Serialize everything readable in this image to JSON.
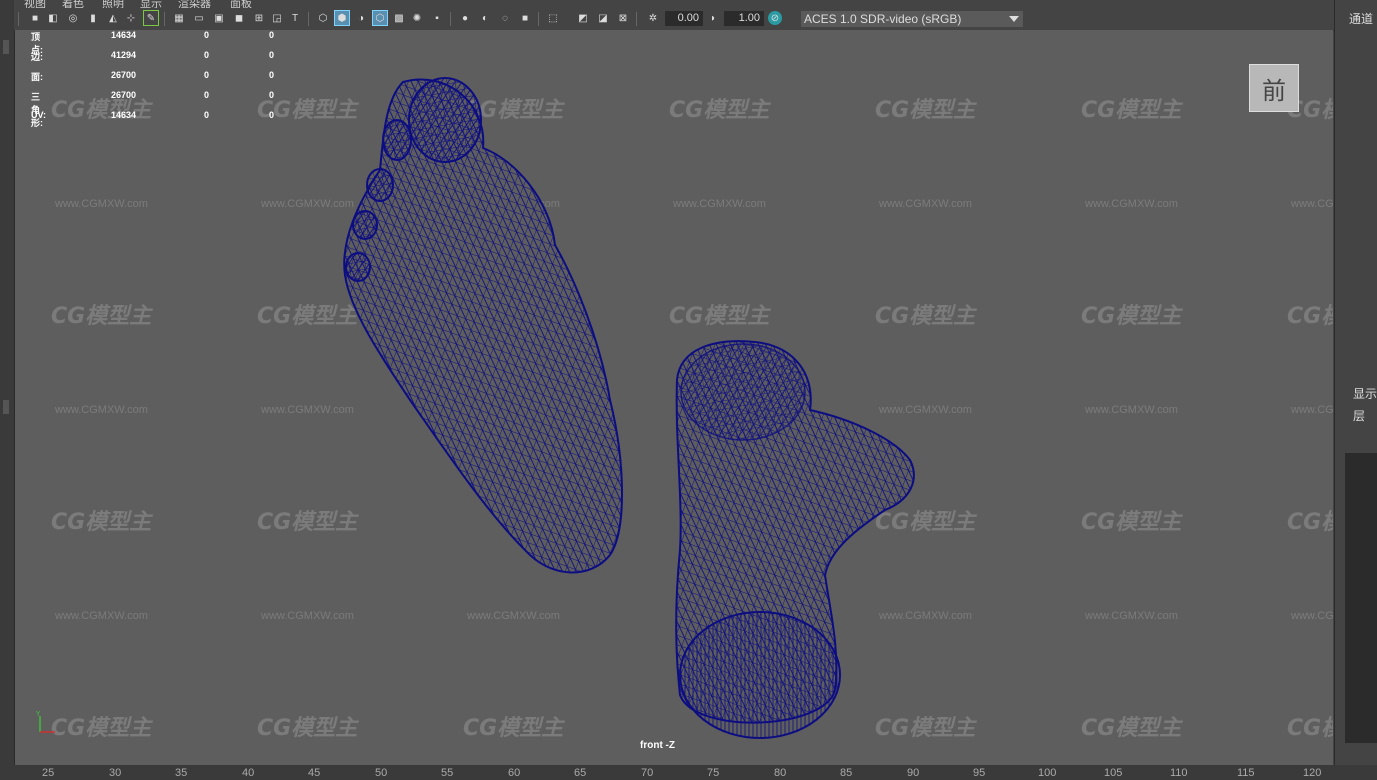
{
  "menu": [
    "视图",
    "着色",
    "照明",
    "显示",
    "渲染器",
    "面板"
  ],
  "toolbar": {
    "exposure_value": "0.00",
    "gamma_value": "1.00",
    "color_management": "ACES 1.0 SDR-video (sRGB)"
  },
  "hud": {
    "rows": [
      {
        "label": "顶点:",
        "a": "14634",
        "b": "0",
        "c": "0"
      },
      {
        "label": "边:",
        "a": "41294",
        "b": "0",
        "c": "0"
      },
      {
        "label": "面:",
        "a": "26700",
        "b": "0",
        "c": "0"
      },
      {
        "label": "三角形:",
        "a": "26700",
        "b": "0",
        "c": "0"
      },
      {
        "label": "UV:",
        "a": "14634",
        "b": "0",
        "c": "0"
      }
    ]
  },
  "view_cube_label": "前",
  "camera_label": "front -Z",
  "watermark": {
    "logo": "CG模型主",
    "url": "www.CGMXW.com"
  },
  "right_panel": {
    "channel": "通道",
    "display": "显示",
    "layer": "层"
  },
  "ruler_ticks": [
    "25",
    "30",
    "35",
    "40",
    "45",
    "50",
    "55",
    "60",
    "65",
    "70",
    "75",
    "80",
    "85",
    "90",
    "95",
    "100",
    "105",
    "110",
    "115",
    "120"
  ],
  "colors": {
    "wireframe": "#0d0d82",
    "viewport_bg": "#5e5e5e",
    "accent": "#5a8fb0"
  }
}
